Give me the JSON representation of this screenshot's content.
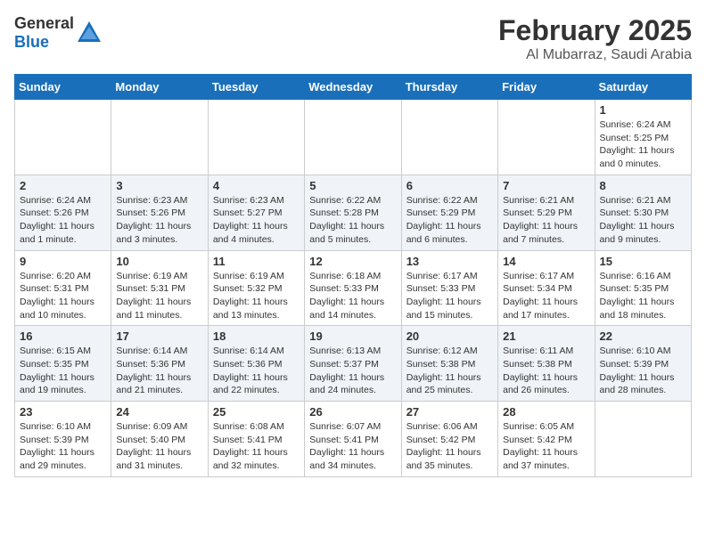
{
  "header": {
    "logo_general": "General",
    "logo_blue": "Blue",
    "month": "February 2025",
    "location": "Al Mubarraz, Saudi Arabia"
  },
  "days_of_week": [
    "Sunday",
    "Monday",
    "Tuesday",
    "Wednesday",
    "Thursday",
    "Friday",
    "Saturday"
  ],
  "weeks": [
    {
      "row_class": "",
      "days": [
        {
          "num": "",
          "info": ""
        },
        {
          "num": "",
          "info": ""
        },
        {
          "num": "",
          "info": ""
        },
        {
          "num": "",
          "info": ""
        },
        {
          "num": "",
          "info": ""
        },
        {
          "num": "",
          "info": ""
        },
        {
          "num": "1",
          "info": "Sunrise: 6:24 AM\nSunset: 5:25 PM\nDaylight: 11 hours\nand 0 minutes."
        }
      ]
    },
    {
      "row_class": "alt-row",
      "days": [
        {
          "num": "2",
          "info": "Sunrise: 6:24 AM\nSunset: 5:26 PM\nDaylight: 11 hours\nand 1 minute."
        },
        {
          "num": "3",
          "info": "Sunrise: 6:23 AM\nSunset: 5:26 PM\nDaylight: 11 hours\nand 3 minutes."
        },
        {
          "num": "4",
          "info": "Sunrise: 6:23 AM\nSunset: 5:27 PM\nDaylight: 11 hours\nand 4 minutes."
        },
        {
          "num": "5",
          "info": "Sunrise: 6:22 AM\nSunset: 5:28 PM\nDaylight: 11 hours\nand 5 minutes."
        },
        {
          "num": "6",
          "info": "Sunrise: 6:22 AM\nSunset: 5:29 PM\nDaylight: 11 hours\nand 6 minutes."
        },
        {
          "num": "7",
          "info": "Sunrise: 6:21 AM\nSunset: 5:29 PM\nDaylight: 11 hours\nand 7 minutes."
        },
        {
          "num": "8",
          "info": "Sunrise: 6:21 AM\nSunset: 5:30 PM\nDaylight: 11 hours\nand 9 minutes."
        }
      ]
    },
    {
      "row_class": "",
      "days": [
        {
          "num": "9",
          "info": "Sunrise: 6:20 AM\nSunset: 5:31 PM\nDaylight: 11 hours\nand 10 minutes."
        },
        {
          "num": "10",
          "info": "Sunrise: 6:19 AM\nSunset: 5:31 PM\nDaylight: 11 hours\nand 11 minutes."
        },
        {
          "num": "11",
          "info": "Sunrise: 6:19 AM\nSunset: 5:32 PM\nDaylight: 11 hours\nand 13 minutes."
        },
        {
          "num": "12",
          "info": "Sunrise: 6:18 AM\nSunset: 5:33 PM\nDaylight: 11 hours\nand 14 minutes."
        },
        {
          "num": "13",
          "info": "Sunrise: 6:17 AM\nSunset: 5:33 PM\nDaylight: 11 hours\nand 15 minutes."
        },
        {
          "num": "14",
          "info": "Sunrise: 6:17 AM\nSunset: 5:34 PM\nDaylight: 11 hours\nand 17 minutes."
        },
        {
          "num": "15",
          "info": "Sunrise: 6:16 AM\nSunset: 5:35 PM\nDaylight: 11 hours\nand 18 minutes."
        }
      ]
    },
    {
      "row_class": "alt-row",
      "days": [
        {
          "num": "16",
          "info": "Sunrise: 6:15 AM\nSunset: 5:35 PM\nDaylight: 11 hours\nand 19 minutes."
        },
        {
          "num": "17",
          "info": "Sunrise: 6:14 AM\nSunset: 5:36 PM\nDaylight: 11 hours\nand 21 minutes."
        },
        {
          "num": "18",
          "info": "Sunrise: 6:14 AM\nSunset: 5:36 PM\nDaylight: 11 hours\nand 22 minutes."
        },
        {
          "num": "19",
          "info": "Sunrise: 6:13 AM\nSunset: 5:37 PM\nDaylight: 11 hours\nand 24 minutes."
        },
        {
          "num": "20",
          "info": "Sunrise: 6:12 AM\nSunset: 5:38 PM\nDaylight: 11 hours\nand 25 minutes."
        },
        {
          "num": "21",
          "info": "Sunrise: 6:11 AM\nSunset: 5:38 PM\nDaylight: 11 hours\nand 26 minutes."
        },
        {
          "num": "22",
          "info": "Sunrise: 6:10 AM\nSunset: 5:39 PM\nDaylight: 11 hours\nand 28 minutes."
        }
      ]
    },
    {
      "row_class": "",
      "days": [
        {
          "num": "23",
          "info": "Sunrise: 6:10 AM\nSunset: 5:39 PM\nDaylight: 11 hours\nand 29 minutes."
        },
        {
          "num": "24",
          "info": "Sunrise: 6:09 AM\nSunset: 5:40 PM\nDaylight: 11 hours\nand 31 minutes."
        },
        {
          "num": "25",
          "info": "Sunrise: 6:08 AM\nSunset: 5:41 PM\nDaylight: 11 hours\nand 32 minutes."
        },
        {
          "num": "26",
          "info": "Sunrise: 6:07 AM\nSunset: 5:41 PM\nDaylight: 11 hours\nand 34 minutes."
        },
        {
          "num": "27",
          "info": "Sunrise: 6:06 AM\nSunset: 5:42 PM\nDaylight: 11 hours\nand 35 minutes."
        },
        {
          "num": "28",
          "info": "Sunrise: 6:05 AM\nSunset: 5:42 PM\nDaylight: 11 hours\nand 37 minutes."
        },
        {
          "num": "",
          "info": ""
        }
      ]
    }
  ]
}
